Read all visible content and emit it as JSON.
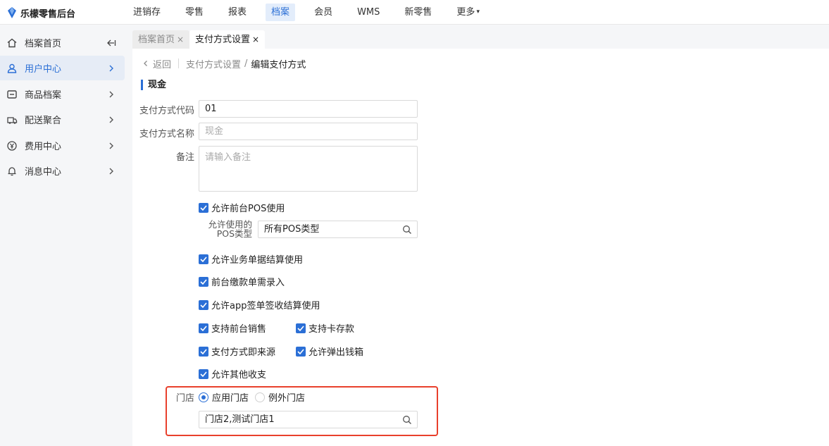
{
  "app": {
    "title": "乐檬零售后台"
  },
  "topnav": [
    {
      "label": "进销存",
      "active": false
    },
    {
      "label": "零售",
      "active": false
    },
    {
      "label": "报表",
      "active": false
    },
    {
      "label": "档案",
      "active": true
    },
    {
      "label": "会员",
      "active": false
    },
    {
      "label": "WMS",
      "active": false
    },
    {
      "label": "新零售",
      "active": false
    },
    {
      "label": "更多",
      "active": false
    }
  ],
  "sidebar": {
    "items": [
      {
        "label": "档案首页",
        "icon": "home-icon"
      },
      {
        "label": "用户中心",
        "icon": "user-icon"
      },
      {
        "label": "商品档案",
        "icon": "product-icon"
      },
      {
        "label": "配送聚合",
        "icon": "delivery-icon"
      },
      {
        "label": "费用中心",
        "icon": "fee-icon"
      },
      {
        "label": "消息中心",
        "icon": "bell-icon"
      }
    ]
  },
  "tabs": [
    {
      "label": "档案首页"
    },
    {
      "label": "支付方式设置"
    }
  ],
  "breadcrumb": {
    "back": "返回",
    "parent": "支付方式设置",
    "slash": "/",
    "current": "编辑支付方式"
  },
  "form": {
    "section_title": "现金",
    "code_label": "支付方式代码",
    "code_value": "01",
    "name_label": "支付方式名称",
    "name_placeholder": "现金",
    "remark_label": "备注",
    "remark_placeholder": "请输入备注",
    "allow_pos": "允许前台POS使用",
    "pos_type_label_1": "允许使用的",
    "pos_type_label_2": "POS类型",
    "pos_type_value": "所有POS类型",
    "allow_business_settle": "允许业务单据结算使用",
    "front_payment_entry": "前台缴款单需录入",
    "allow_app_settle": "允许app签单签收结算使用",
    "support_front_sales": "支持前台销售",
    "support_card_deposit": "支持卡存款",
    "payment_is_source": "支付方式即来源",
    "allow_cash_drawer": "允许弹出钱箱",
    "allow_other_income": "允许其他收支",
    "store_label": "门店",
    "store_apply": "应用门店",
    "store_except": "例外门店",
    "store_value": "门店2,测试门店1"
  },
  "colors": {
    "accent": "#2b6fd6",
    "highlight": "#e8402c"
  }
}
